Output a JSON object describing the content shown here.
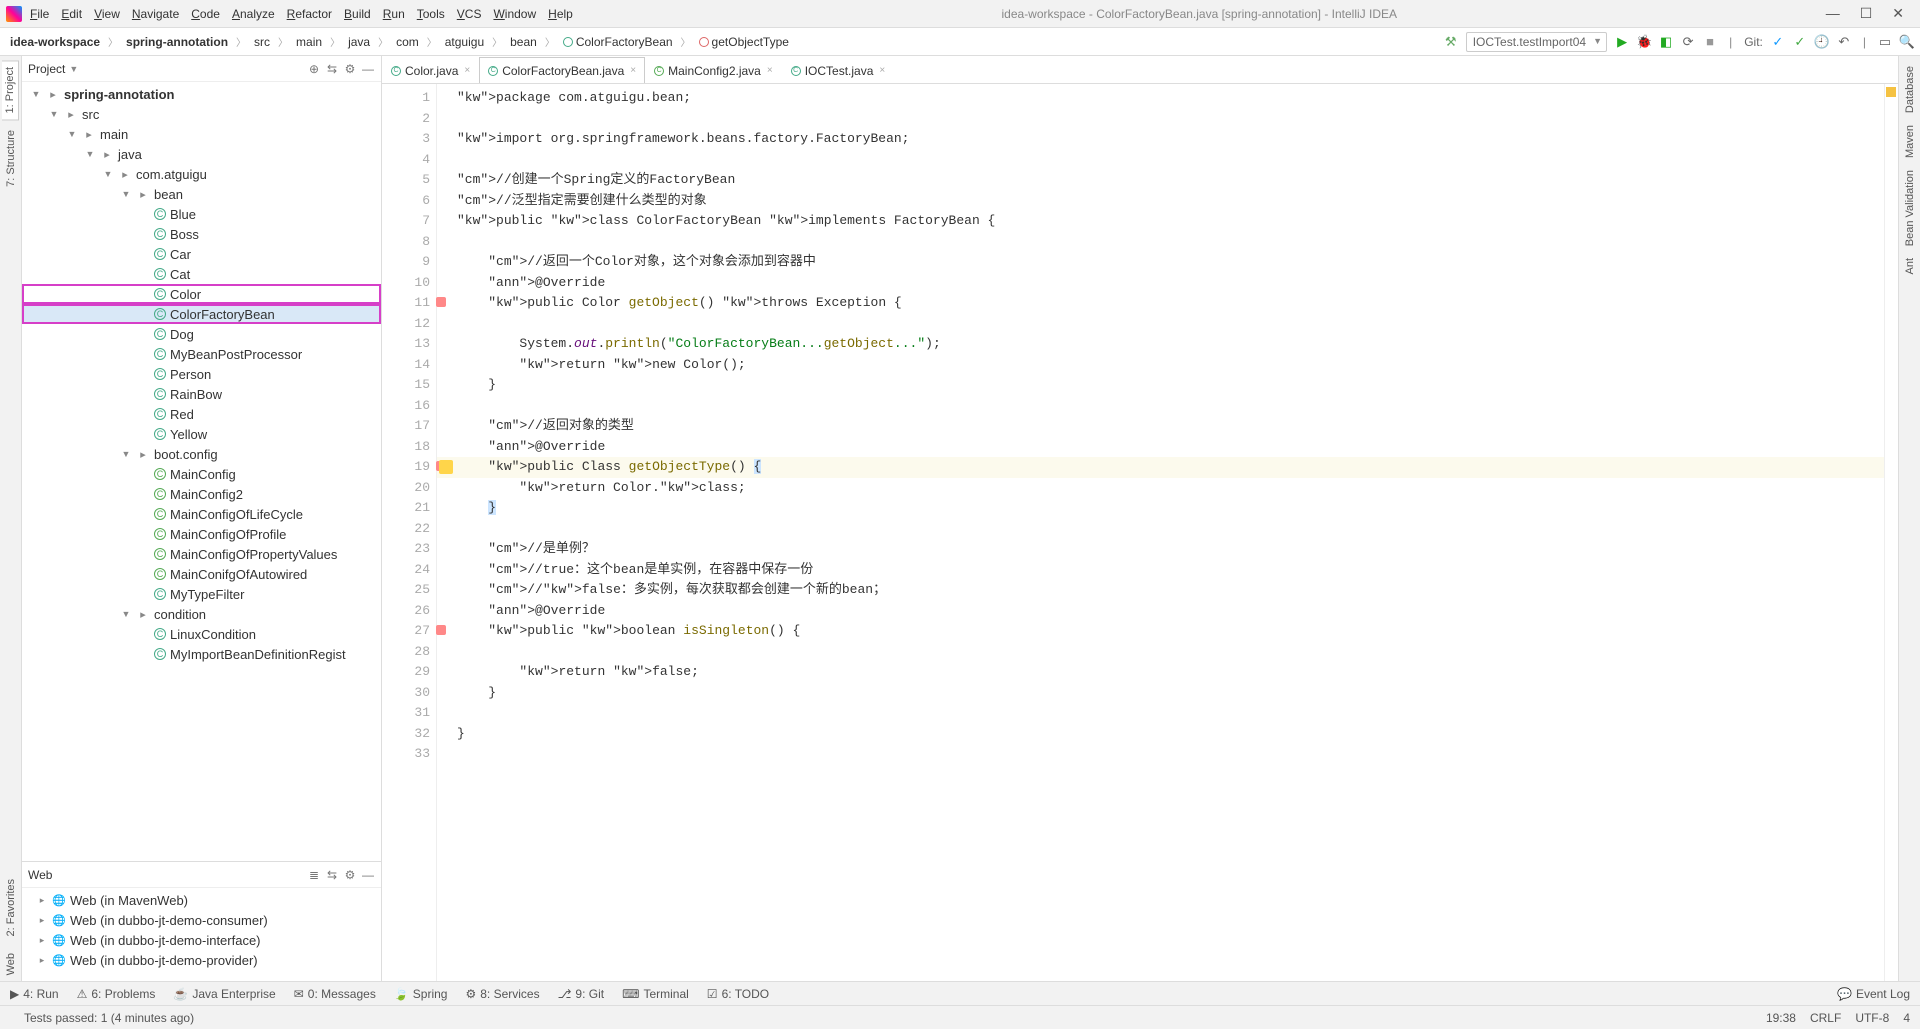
{
  "title": "idea-workspace - ColorFactoryBean.java [spring-annotation] - IntelliJ IDEA",
  "menu": [
    "File",
    "Edit",
    "View",
    "Navigate",
    "Code",
    "Analyze",
    "Refactor",
    "Build",
    "Run",
    "Tools",
    "VCS",
    "Window",
    "Help"
  ],
  "breadcrumb": [
    "idea-workspace",
    "spring-annotation",
    "src",
    "main",
    "java",
    "com",
    "atguigu",
    "bean",
    "ColorFactoryBean",
    "getObjectType"
  ],
  "runConfig": "IOCTest.testImport04",
  "git_label": "Git:",
  "rails_left": [
    "1: Project",
    "7: Structure",
    "2: Favorites",
    "Web"
  ],
  "rails_right": [
    "Database",
    "Maven",
    "Bean Validation",
    "Ant"
  ],
  "project": {
    "title": "Project",
    "tree": [
      {
        "d": 0,
        "e": 1,
        "i": "folder",
        "t": "spring-annotation",
        "b": 1
      },
      {
        "d": 1,
        "e": 1,
        "i": "folder",
        "t": "src"
      },
      {
        "d": 2,
        "e": 1,
        "i": "folder",
        "t": "main"
      },
      {
        "d": 3,
        "e": 1,
        "i": "folder",
        "t": "java"
      },
      {
        "d": 4,
        "e": 1,
        "i": "folder",
        "t": "com.atguigu"
      },
      {
        "d": 5,
        "e": 1,
        "i": "folder",
        "t": "bean"
      },
      {
        "d": 6,
        "e": 0,
        "i": "cls",
        "t": "Blue"
      },
      {
        "d": 6,
        "e": 0,
        "i": "cls",
        "t": "Boss"
      },
      {
        "d": 6,
        "e": 0,
        "i": "cls",
        "t": "Car"
      },
      {
        "d": 6,
        "e": 0,
        "i": "cls",
        "t": "Cat"
      },
      {
        "d": 6,
        "e": 0,
        "i": "cls",
        "t": "Color",
        "hl": 1
      },
      {
        "d": 6,
        "e": 0,
        "i": "cls",
        "t": "ColorFactoryBean",
        "hl": 1,
        "sel": 1
      },
      {
        "d": 6,
        "e": 0,
        "i": "cls",
        "t": "Dog"
      },
      {
        "d": 6,
        "e": 0,
        "i": "cls",
        "t": "MyBeanPostProcessor"
      },
      {
        "d": 6,
        "e": 0,
        "i": "cls",
        "t": "Person"
      },
      {
        "d": 6,
        "e": 0,
        "i": "cls",
        "t": "RainBow"
      },
      {
        "d": 6,
        "e": 0,
        "i": "cls",
        "t": "Red"
      },
      {
        "d": 6,
        "e": 0,
        "i": "cls",
        "t": "Yellow"
      },
      {
        "d": 5,
        "e": 1,
        "i": "folder",
        "t": "boot.config"
      },
      {
        "d": 6,
        "e": 0,
        "i": "cls-g",
        "t": "MainConfig"
      },
      {
        "d": 6,
        "e": 0,
        "i": "cls-g",
        "t": "MainConfig2"
      },
      {
        "d": 6,
        "e": 0,
        "i": "cls-g",
        "t": "MainConfigOfLifeCycle"
      },
      {
        "d": 6,
        "e": 0,
        "i": "cls-g",
        "t": "MainConfigOfProfile"
      },
      {
        "d": 6,
        "e": 0,
        "i": "cls-g",
        "t": "MainConfigOfPropertyValues"
      },
      {
        "d": 6,
        "e": 0,
        "i": "cls-g",
        "t": "MainConifgOfAutowired"
      },
      {
        "d": 6,
        "e": 0,
        "i": "cls",
        "t": "MyTypeFilter"
      },
      {
        "d": 5,
        "e": 1,
        "i": "folder",
        "t": "condition"
      },
      {
        "d": 6,
        "e": 0,
        "i": "cls",
        "t": "LinuxCondition"
      },
      {
        "d": 6,
        "e": 0,
        "i": "cls",
        "t": "MyImportBeanDefinitionRegist"
      }
    ]
  },
  "web": {
    "title": "Web",
    "items": [
      "Web (in MavenWeb)",
      "Web (in dubbo-jt-demo-consumer)",
      "Web (in dubbo-jt-demo-interface)",
      "Web (in dubbo-jt-demo-provider)"
    ]
  },
  "tabs": [
    {
      "label": "Color.java",
      "active": false,
      "ico": "c"
    },
    {
      "label": "ColorFactoryBean.java",
      "active": true,
      "ico": "c"
    },
    {
      "label": "MainConfig2.java",
      "active": false,
      "ico": "g"
    },
    {
      "label": "IOCTest.java",
      "active": false,
      "ico": "c"
    }
  ],
  "code": {
    "lines": [
      "package com.atguigu.bean;",
      "",
      "import org.springframework.beans.factory.FactoryBean;",
      "",
      "//创建一个Spring定义的FactoryBean",
      "//泛型指定需要创建什么类型的对象",
      "public class ColorFactoryBean implements FactoryBean<Color> {",
      "",
      "    //返回一个Color对象，这个对象会添加到容器中",
      "    @Override",
      "    public Color getObject() throws Exception {",
      "",
      "        System.out.println(\"ColorFactoryBean...getObject...\");",
      "        return new Color();",
      "    }",
      "",
      "    //返回对象的类型",
      "    @Override",
      "    public Class<?> getObjectType() {",
      "        return Color.class;",
      "    }",
      "",
      "    //是单例？",
      "    //true：这个bean是单实例，在容器中保存一份",
      "    //false：多实例，每次获取都会创建一个新的bean；",
      "    @Override",
      "    public boolean isSingleton() {",
      "",
      "        return false;",
      "    }",
      "",
      "}",
      ""
    ]
  },
  "bottomTools": [
    "4: Run",
    "6: Problems",
    "Java Enterprise",
    "0: Messages",
    "Spring",
    "8: Services",
    "9: Git",
    "Terminal",
    "6: TODO"
  ],
  "eventLog": "Event Log",
  "status": {
    "msg": "Tests passed: 1 (4 minutes ago)",
    "time": "19:38",
    "lineend": "CRLF",
    "enc": "UTF-8",
    "indent": "4"
  }
}
